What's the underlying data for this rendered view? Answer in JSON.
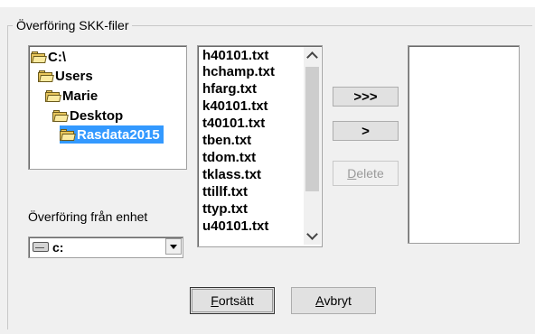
{
  "group_title": "Överföring SKK-filer",
  "tree": {
    "items": [
      {
        "label": "C:\\",
        "icon": "folder-open-icon",
        "selected": false
      },
      {
        "label": "Users",
        "icon": "folder-open-icon",
        "selected": false
      },
      {
        "label": "Marie",
        "icon": "folder-open-icon",
        "selected": false
      },
      {
        "label": "Desktop",
        "icon": "folder-open-icon",
        "selected": false
      },
      {
        "label": "Rasdata2015",
        "icon": "folder-open-icon",
        "selected": true
      }
    ]
  },
  "device": {
    "label": "Överföring från enhet",
    "selected_value": "c:",
    "icon": "drive-icon"
  },
  "files": [
    "h40101.txt",
    "hchamp.txt",
    "hfarg.txt",
    "k40101.txt",
    "t40101.txt",
    "tben.txt",
    "tdom.txt",
    "tklass.txt",
    "ttillf.txt",
    "ttyp.txt",
    "u40101.txt"
  ],
  "buttons": {
    "move_all": ">>>",
    "move_one": ">",
    "delete_prefix": "D",
    "delete_rest": "elete",
    "continue_prefix": "F",
    "continue_rest": "ortsätt",
    "cancel_prefix": "A",
    "cancel_rest": "vbryt"
  },
  "target_list": []
}
